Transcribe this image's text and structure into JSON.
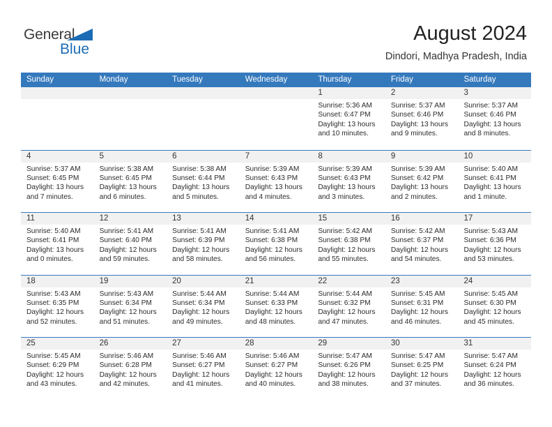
{
  "brand": {
    "name_top": "General",
    "name_bottom": "Blue",
    "triangle_color": "#1b6cb5",
    "text_color": "#3a3a3a"
  },
  "header": {
    "month_title": "August 2024",
    "location": "Dindori, Madhya Pradesh, India"
  },
  "theme": {
    "header_bar": "#3579bd",
    "day_number_band": "#f1f1f1",
    "row_divider": "#3579bd",
    "page_background": "#ffffff"
  },
  "calendar": {
    "weekday_headers": [
      "Sunday",
      "Monday",
      "Tuesday",
      "Wednesday",
      "Thursday",
      "Friday",
      "Saturday"
    ],
    "weeks": [
      [
        {
          "day": "",
          "empty": true
        },
        {
          "day": "",
          "empty": true
        },
        {
          "day": "",
          "empty": true
        },
        {
          "day": "",
          "empty": true
        },
        {
          "day": "1",
          "sunrise": "Sunrise: 5:36 AM",
          "sunset": "Sunset: 6:47 PM",
          "daylight_1": "Daylight: 13 hours",
          "daylight_2": "and 10 minutes."
        },
        {
          "day": "2",
          "sunrise": "Sunrise: 5:37 AM",
          "sunset": "Sunset: 6:46 PM",
          "daylight_1": "Daylight: 13 hours",
          "daylight_2": "and 9 minutes."
        },
        {
          "day": "3",
          "sunrise": "Sunrise: 5:37 AM",
          "sunset": "Sunset: 6:46 PM",
          "daylight_1": "Daylight: 13 hours",
          "daylight_2": "and 8 minutes."
        }
      ],
      [
        {
          "day": "4",
          "sunrise": "Sunrise: 5:37 AM",
          "sunset": "Sunset: 6:45 PM",
          "daylight_1": "Daylight: 13 hours",
          "daylight_2": "and 7 minutes."
        },
        {
          "day": "5",
          "sunrise": "Sunrise: 5:38 AM",
          "sunset": "Sunset: 6:45 PM",
          "daylight_1": "Daylight: 13 hours",
          "daylight_2": "and 6 minutes."
        },
        {
          "day": "6",
          "sunrise": "Sunrise: 5:38 AM",
          "sunset": "Sunset: 6:44 PM",
          "daylight_1": "Daylight: 13 hours",
          "daylight_2": "and 5 minutes."
        },
        {
          "day": "7",
          "sunrise": "Sunrise: 5:39 AM",
          "sunset": "Sunset: 6:43 PM",
          "daylight_1": "Daylight: 13 hours",
          "daylight_2": "and 4 minutes."
        },
        {
          "day": "8",
          "sunrise": "Sunrise: 5:39 AM",
          "sunset": "Sunset: 6:43 PM",
          "daylight_1": "Daylight: 13 hours",
          "daylight_2": "and 3 minutes."
        },
        {
          "day": "9",
          "sunrise": "Sunrise: 5:39 AM",
          "sunset": "Sunset: 6:42 PM",
          "daylight_1": "Daylight: 13 hours",
          "daylight_2": "and 2 minutes."
        },
        {
          "day": "10",
          "sunrise": "Sunrise: 5:40 AM",
          "sunset": "Sunset: 6:41 PM",
          "daylight_1": "Daylight: 13 hours",
          "daylight_2": "and 1 minute."
        }
      ],
      [
        {
          "day": "11",
          "sunrise": "Sunrise: 5:40 AM",
          "sunset": "Sunset: 6:41 PM",
          "daylight_1": "Daylight: 13 hours",
          "daylight_2": "and 0 minutes."
        },
        {
          "day": "12",
          "sunrise": "Sunrise: 5:41 AM",
          "sunset": "Sunset: 6:40 PM",
          "daylight_1": "Daylight: 12 hours",
          "daylight_2": "and 59 minutes."
        },
        {
          "day": "13",
          "sunrise": "Sunrise: 5:41 AM",
          "sunset": "Sunset: 6:39 PM",
          "daylight_1": "Daylight: 12 hours",
          "daylight_2": "and 58 minutes."
        },
        {
          "day": "14",
          "sunrise": "Sunrise: 5:41 AM",
          "sunset": "Sunset: 6:38 PM",
          "daylight_1": "Daylight: 12 hours",
          "daylight_2": "and 56 minutes."
        },
        {
          "day": "15",
          "sunrise": "Sunrise: 5:42 AM",
          "sunset": "Sunset: 6:38 PM",
          "daylight_1": "Daylight: 12 hours",
          "daylight_2": "and 55 minutes."
        },
        {
          "day": "16",
          "sunrise": "Sunrise: 5:42 AM",
          "sunset": "Sunset: 6:37 PM",
          "daylight_1": "Daylight: 12 hours",
          "daylight_2": "and 54 minutes."
        },
        {
          "day": "17",
          "sunrise": "Sunrise: 5:43 AM",
          "sunset": "Sunset: 6:36 PM",
          "daylight_1": "Daylight: 12 hours",
          "daylight_2": "and 53 minutes."
        }
      ],
      [
        {
          "day": "18",
          "sunrise": "Sunrise: 5:43 AM",
          "sunset": "Sunset: 6:35 PM",
          "daylight_1": "Daylight: 12 hours",
          "daylight_2": "and 52 minutes."
        },
        {
          "day": "19",
          "sunrise": "Sunrise: 5:43 AM",
          "sunset": "Sunset: 6:34 PM",
          "daylight_1": "Daylight: 12 hours",
          "daylight_2": "and 51 minutes."
        },
        {
          "day": "20",
          "sunrise": "Sunrise: 5:44 AM",
          "sunset": "Sunset: 6:34 PM",
          "daylight_1": "Daylight: 12 hours",
          "daylight_2": "and 49 minutes."
        },
        {
          "day": "21",
          "sunrise": "Sunrise: 5:44 AM",
          "sunset": "Sunset: 6:33 PM",
          "daylight_1": "Daylight: 12 hours",
          "daylight_2": "and 48 minutes."
        },
        {
          "day": "22",
          "sunrise": "Sunrise: 5:44 AM",
          "sunset": "Sunset: 6:32 PM",
          "daylight_1": "Daylight: 12 hours",
          "daylight_2": "and 47 minutes."
        },
        {
          "day": "23",
          "sunrise": "Sunrise: 5:45 AM",
          "sunset": "Sunset: 6:31 PM",
          "daylight_1": "Daylight: 12 hours",
          "daylight_2": "and 46 minutes."
        },
        {
          "day": "24",
          "sunrise": "Sunrise: 5:45 AM",
          "sunset": "Sunset: 6:30 PM",
          "daylight_1": "Daylight: 12 hours",
          "daylight_2": "and 45 minutes."
        }
      ],
      [
        {
          "day": "25",
          "sunrise": "Sunrise: 5:45 AM",
          "sunset": "Sunset: 6:29 PM",
          "daylight_1": "Daylight: 12 hours",
          "daylight_2": "and 43 minutes."
        },
        {
          "day": "26",
          "sunrise": "Sunrise: 5:46 AM",
          "sunset": "Sunset: 6:28 PM",
          "daylight_1": "Daylight: 12 hours",
          "daylight_2": "and 42 minutes."
        },
        {
          "day": "27",
          "sunrise": "Sunrise: 5:46 AM",
          "sunset": "Sunset: 6:27 PM",
          "daylight_1": "Daylight: 12 hours",
          "daylight_2": "and 41 minutes."
        },
        {
          "day": "28",
          "sunrise": "Sunrise: 5:46 AM",
          "sunset": "Sunset: 6:27 PM",
          "daylight_1": "Daylight: 12 hours",
          "daylight_2": "and 40 minutes."
        },
        {
          "day": "29",
          "sunrise": "Sunrise: 5:47 AM",
          "sunset": "Sunset: 6:26 PM",
          "daylight_1": "Daylight: 12 hours",
          "daylight_2": "and 38 minutes."
        },
        {
          "day": "30",
          "sunrise": "Sunrise: 5:47 AM",
          "sunset": "Sunset: 6:25 PM",
          "daylight_1": "Daylight: 12 hours",
          "daylight_2": "and 37 minutes."
        },
        {
          "day": "31",
          "sunrise": "Sunrise: 5:47 AM",
          "sunset": "Sunset: 6:24 PM",
          "daylight_1": "Daylight: 12 hours",
          "daylight_2": "and 36 minutes."
        }
      ]
    ]
  }
}
